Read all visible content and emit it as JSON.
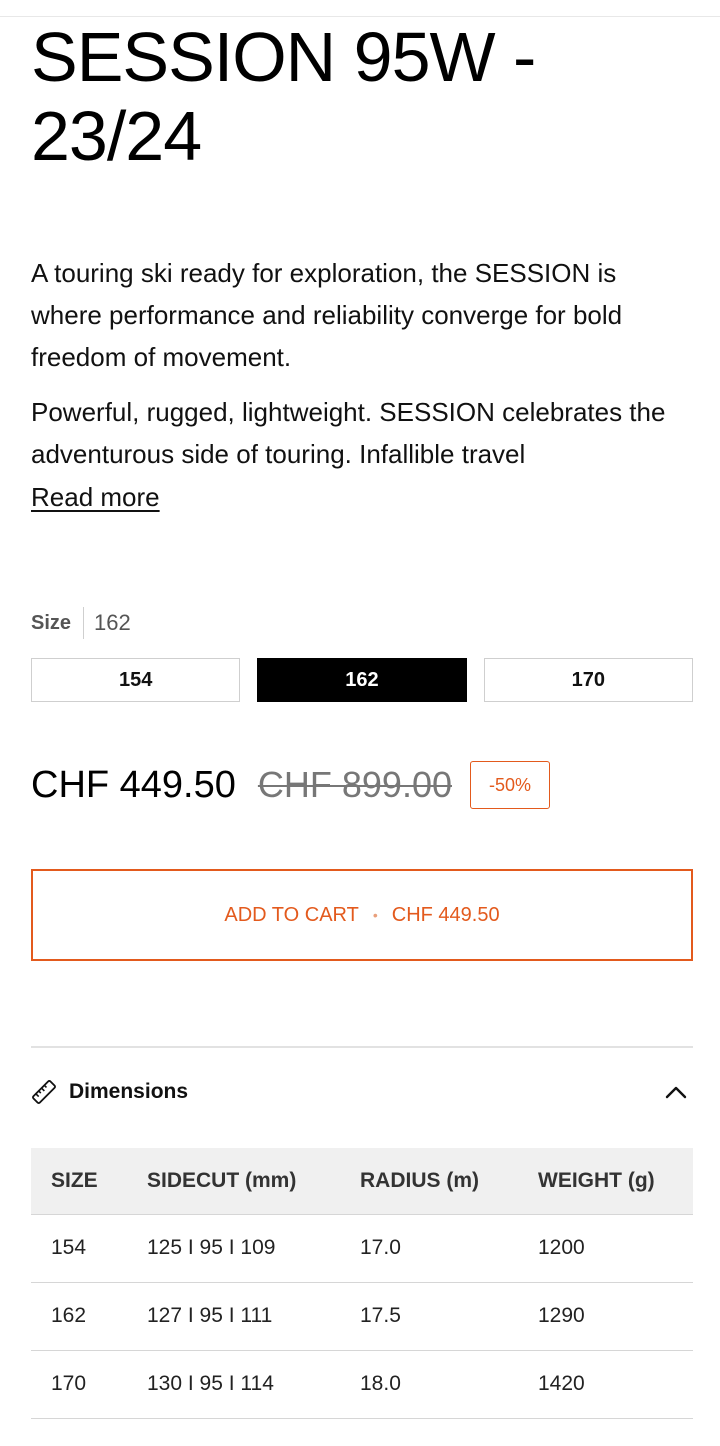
{
  "product": {
    "title": "SESSION 95W - 23/24",
    "description": [
      "A touring ski ready for exploration, the SESSION is where performance and reliability converge for bold freedom of movement.",
      "Powerful, rugged, lightweight. SESSION celebrates the adventurous side of touring. Infallible travel"
    ],
    "read_more_label": "Read more"
  },
  "size_selector": {
    "label": "Size",
    "selected": "162",
    "options": [
      "154",
      "162",
      "170"
    ]
  },
  "pricing": {
    "current": "CHF 449.50",
    "original": "CHF 899.00",
    "discount": "-50%"
  },
  "cart": {
    "label": "ADD TO CART",
    "separator": "•",
    "price": "CHF 449.50"
  },
  "dimensions": {
    "title": "Dimensions",
    "headers": [
      "SIZE",
      "SIDECUT (mm)",
      "RADIUS (m)",
      "WEIGHT (g)"
    ],
    "rows": [
      [
        "154",
        "125 I 95 I 109",
        "17.0",
        "1200"
      ],
      [
        "162",
        "127 I 95 I 111",
        "17.5",
        "1290"
      ],
      [
        "170",
        "130 I 95 I 114",
        "18.0",
        "1420"
      ]
    ]
  },
  "colors": {
    "accent": "#e35a1d",
    "selected_bg": "#000000",
    "table_header_bg": "#f0f0f0"
  },
  "icons": {
    "dimensions": "ruler-icon",
    "toggle": "chevron-up-icon"
  }
}
